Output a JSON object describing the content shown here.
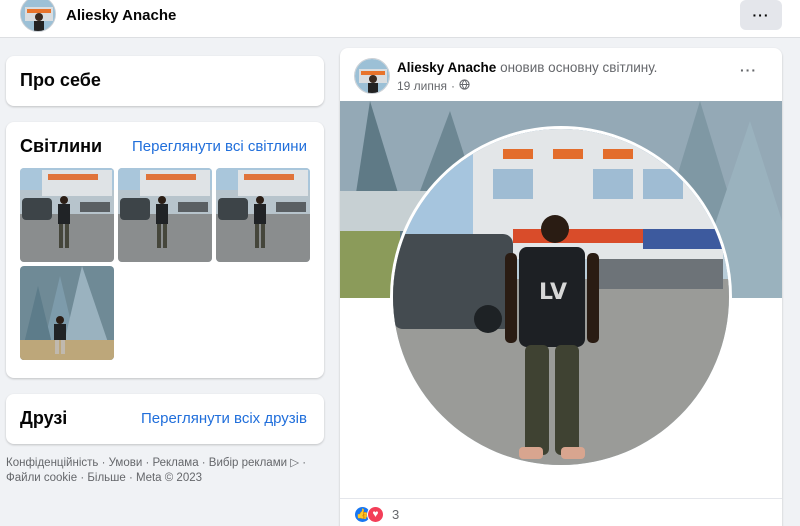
{
  "header": {
    "name": "Aliesky Anache",
    "more_label": "···"
  },
  "about": {
    "title": "Про себе"
  },
  "photos": {
    "title": "Світлини",
    "link": "Переглянути всі світлини",
    "thumbs": [
      "photo-1",
      "photo-2",
      "photo-3",
      "photo-4"
    ]
  },
  "friends": {
    "title": "Друзі",
    "link": "Переглянути всіх друзів"
  },
  "footer": {
    "line1": "Конфіденційність · Умови · Реклама · Вибір реклами ▷ ·",
    "line2": "Файли cookie · Більше · Meta © 2023"
  },
  "post": {
    "author": "Aliesky Anache",
    "action": "оновив основну світлину.",
    "date": "19 липня",
    "separator": "·",
    "more_label": "···",
    "reaction_count": "3",
    "colors": {
      "like": "#1877f2",
      "love": "#f33e58"
    }
  }
}
